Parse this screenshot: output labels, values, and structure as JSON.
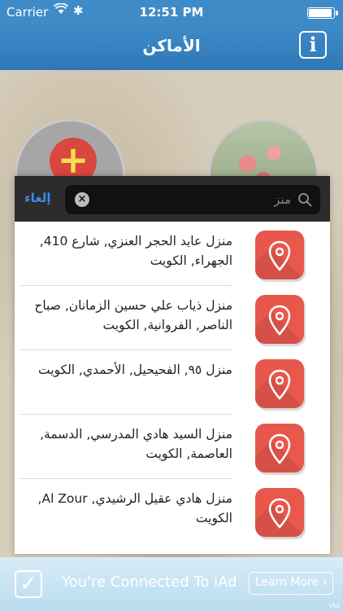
{
  "status_bar": {
    "carrier": "Carrier",
    "time": "12:51 PM"
  },
  "nav": {
    "title": "الأماكن",
    "info_icon": "info-icon",
    "info_label": "i"
  },
  "search": {
    "cancel_label": "إلغاء",
    "query": "منز",
    "clear_label": "×"
  },
  "results": [
    {
      "text": "منزل عايد الحجر العنزي, شارع 410, الجهراء, الكويت"
    },
    {
      "text": "منزل ذياب علي حسين الزمانان, صباح الناصر, الفروانية, الكويت"
    },
    {
      "text": "منزل ٩٥, الفحيحيل, الأحمدي, الكويت"
    },
    {
      "text": "منزل السيد هادي المدرسي, الدسمة, العاصمة, الكويت"
    },
    {
      "text": "منزل هادي عقيل الرشيدي, Al Zour, الكويت"
    }
  ],
  "ad": {
    "check": "✓",
    "text": "You're Connected To iAd",
    "button": "Learn More ›",
    "mark": "iAd"
  },
  "colors": {
    "accent": "#3a8ee6",
    "nav": "#3f8bc8",
    "pin": "#e8574c"
  }
}
